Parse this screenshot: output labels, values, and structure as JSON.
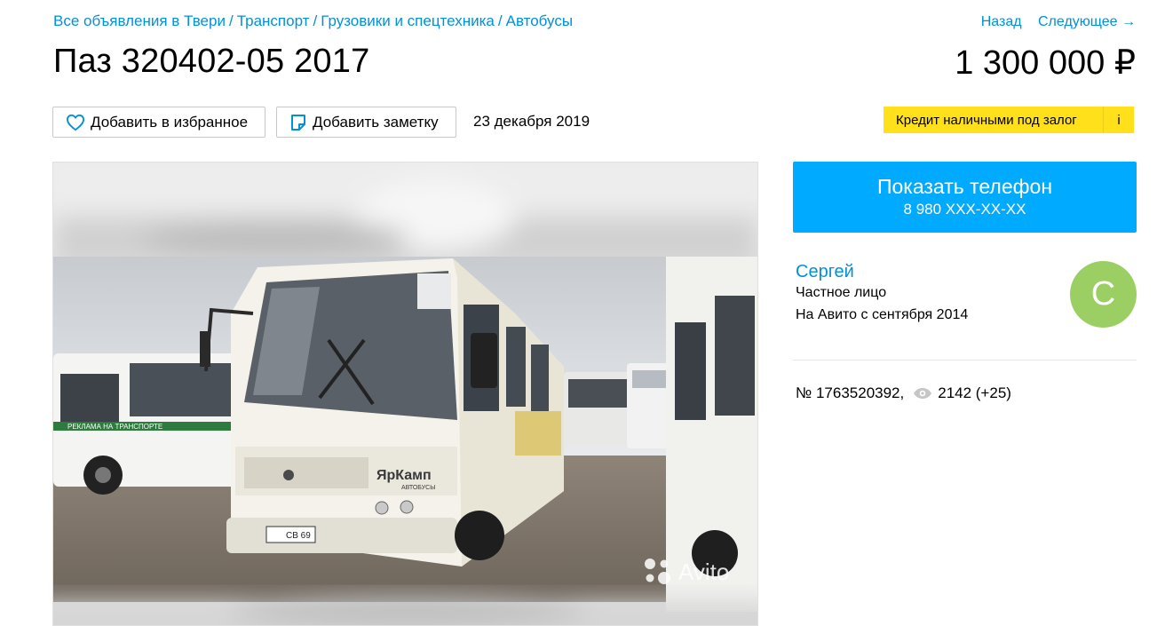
{
  "breadcrumb": [
    {
      "label": "Все объявления в Твери"
    },
    {
      "label": "Транспорт"
    },
    {
      "label": "Грузовики и спецтехника"
    },
    {
      "label": "Автобусы"
    }
  ],
  "breadcrumb_separator": "/",
  "nav": {
    "back_label": "Назад",
    "next_label": "Следующее →"
  },
  "listing": {
    "title": "Паз 320402-05 2017",
    "price": "1 300 000 ₽",
    "date": "23 декабря 2019",
    "number": "№ 1763520392,",
    "views": "2142 (+25)"
  },
  "actions": {
    "favorite_label": "Добавить в избранное",
    "note_label": "Добавить заметку"
  },
  "credit": {
    "label": "Кредит наличными под залог",
    "info": "i"
  },
  "contact": {
    "button_label": "Показать телефон",
    "phone": "8 980 XXX-XX-XX"
  },
  "seller": {
    "name": "Сергей",
    "type": "Частное лицо",
    "since": "На Авито с сентября 2014",
    "avatar_letter": "С"
  },
  "photo": {
    "watermark": "Avito",
    "bus_brand": "ЯрКамп",
    "bus_brand_sub": "АВТОБУСЫ",
    "plate": "СВ 69",
    "side_stripe": "РЕКЛАМА НА ТРАНСПОРТЕ"
  },
  "icons": {
    "favorite": "heart-icon",
    "note": "note-icon",
    "views": "eye-icon"
  },
  "colors": {
    "link": "#0091d9",
    "phone_button": "#00aaff",
    "credit_badge": "#ffe01a",
    "avatar": "#9bcf64"
  }
}
